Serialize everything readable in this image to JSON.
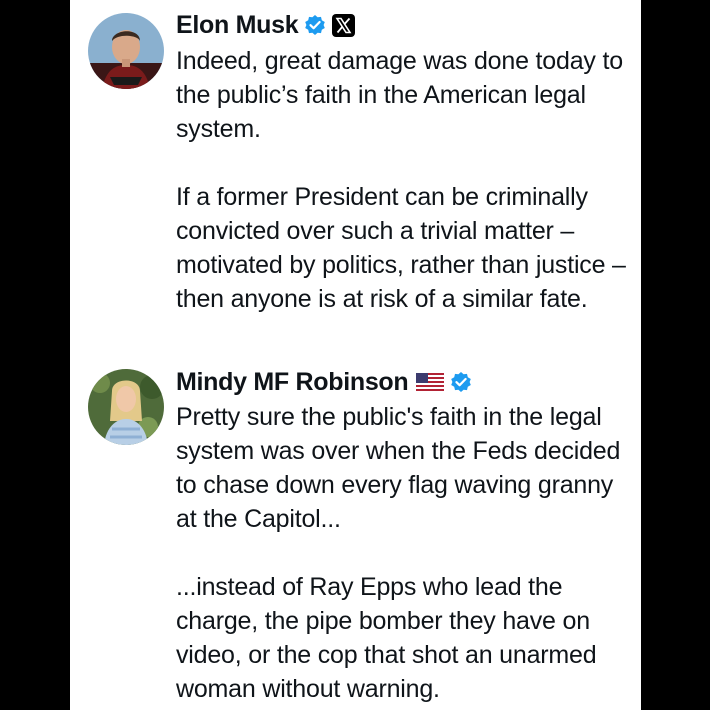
{
  "colors": {
    "background": "#000000",
    "card": "#ffffff",
    "text": "#0f1419",
    "verified": "#1d9bf0"
  },
  "posts": [
    {
      "author": "Elon Musk",
      "icons": [
        "verified-badge-icon",
        "x-logo-icon"
      ],
      "paragraphs": [
        "Indeed, great damage was done today to the public’s faith in the American legal system.",
        "If a former President can be criminally convicted over such a trivial matter – motivated by politics, rather than justice – then anyone is at risk of a similar fate."
      ]
    },
    {
      "author": "Mindy MF Robinson",
      "icons": [
        "us-flag-icon",
        "verified-badge-icon"
      ],
      "paragraphs": [
        "Pretty sure the public's faith in the legal system was over when the Feds decided to chase down every flag waving granny at the Capitol...",
        "...instead of Ray Epps who lead the charge, the pipe bomber they have on video, or the cop that shot an unarmed woman without warning."
      ]
    }
  ]
}
